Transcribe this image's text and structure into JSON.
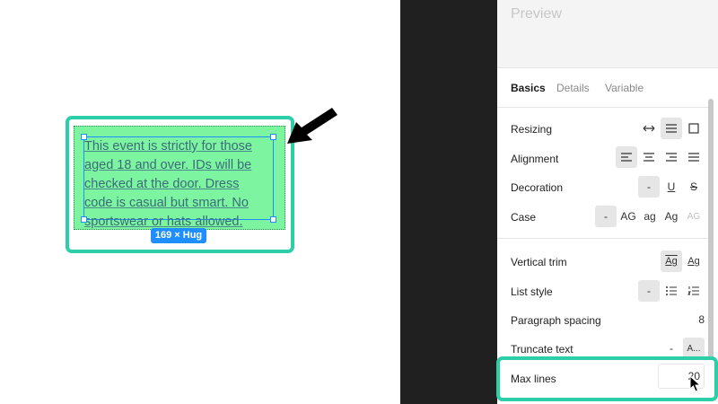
{
  "canvas": {
    "text_lines": [
      "This event is strictly for those",
      "aged 18 and over. IDs will be",
      "checked at the door. Dress",
      "code is casual but smart. No",
      "sportswear or hats allowed."
    ],
    "size_badge": "169 × Hug"
  },
  "panel": {
    "preview_title": "Preview",
    "tabs": [
      {
        "label": "Basics"
      },
      {
        "label": "Details"
      },
      {
        "label": "Variable"
      }
    ],
    "rows": {
      "resizing": "Resizing",
      "alignment": "Alignment",
      "decoration": "Decoration",
      "decoration_none": "-",
      "decoration_underline": "U",
      "decoration_strike": "S",
      "case": "Case",
      "case_none": "-",
      "case_upper": "AG",
      "case_lower": "ag",
      "case_title": "Ag",
      "case_small": "AG",
      "vertical_trim": "Vertical trim",
      "trim_a": "Ag",
      "trim_b": "Ag",
      "list_style": "List style",
      "list_none": "-",
      "paragraph_spacing": "Paragraph spacing",
      "paragraph_spacing_value": "8",
      "truncate_text": "Truncate text",
      "truncate_none": "-",
      "truncate_ellipsis": "A...",
      "max_lines": "Max lines",
      "max_lines_value": "20"
    }
  },
  "colors": {
    "highlight": "#2ecfa8",
    "frame_fill": "#7df5a0",
    "selection": "#1f8fff"
  }
}
